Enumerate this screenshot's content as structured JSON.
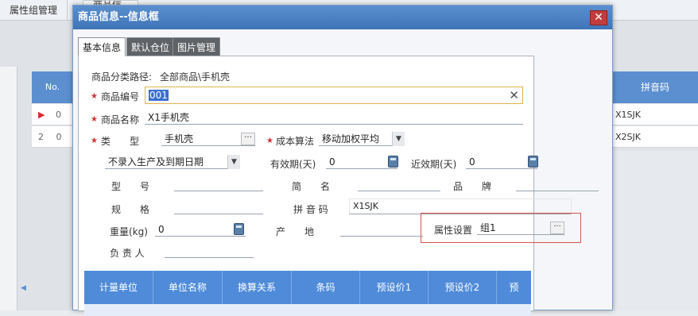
{
  "background": {
    "tabs": [
      "属性组管理",
      "商品信息"
    ],
    "grid_left": {
      "header": "No.",
      "rows": [
        {
          "marker": "▶",
          "text": "0"
        },
        {
          "marker": "2",
          "text": "0"
        }
      ]
    },
    "grid_right": {
      "header": "拼音码",
      "rows": [
        "X1SJK",
        "X2SJK"
      ]
    }
  },
  "dialog": {
    "title": "商品信息--信息框",
    "close_symbol": "✕",
    "tabs": [
      "基本信息",
      "默认仓位",
      "图片管理"
    ],
    "category_path_label": "商品分类路径:",
    "category_path_value": "全部商品\\手机壳",
    "fields": {
      "code": {
        "label": "商品编号",
        "value": "001"
      },
      "name": {
        "label": "商品名称",
        "value": "X1手机壳"
      },
      "type": {
        "label": "类　　型",
        "value": "手机壳"
      },
      "cost_method": {
        "label": "成本算法",
        "value": "移动加权平均"
      },
      "expiry_mode": {
        "value": "不录入生产及到期日期"
      },
      "shelf_life": {
        "label": "有效期(天)",
        "value": "0"
      },
      "near_expiry": {
        "label": "近效期(天)",
        "value": "0"
      },
      "model": {
        "label": "型　　号",
        "value": ""
      },
      "short_name": {
        "label": "简　　名",
        "value": ""
      },
      "brand": {
        "label": "品　　牌",
        "value": ""
      },
      "spec": {
        "label": "规　　格",
        "value": ""
      },
      "pinyin": {
        "label": "拼 音 码",
        "value": "X1SJK"
      },
      "weight": {
        "label": "重量(kg)",
        "value": "0"
      },
      "origin": {
        "label": "产　　地",
        "value": ""
      },
      "attribute": {
        "label": "属性设置",
        "value": "组1"
      },
      "owner": {
        "label": "负 责 人",
        "value": ""
      }
    },
    "grid_headers": [
      "计量单位",
      "单位名称",
      "换算关系",
      "条码",
      "预设价1",
      "预设价2",
      "预"
    ]
  },
  "colors": {
    "title_bar": "#4a80c4",
    "grid_header": "#4f8bd9",
    "required_star": "#d32f2f",
    "highlight_border": "#d9534f"
  }
}
